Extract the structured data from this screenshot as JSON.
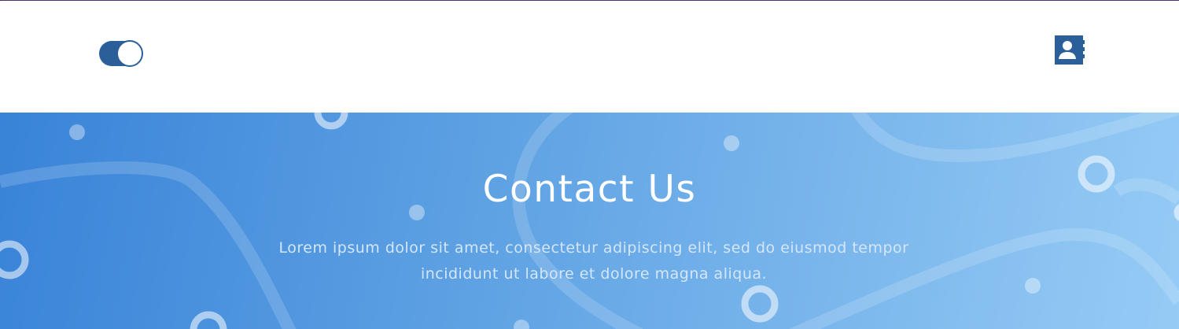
{
  "header": {
    "logo_icon": "toggle-logo-icon",
    "contact_icon": "contact-card-icon",
    "colors": {
      "brand": "#2b5f9a",
      "background": "#ffffff"
    }
  },
  "hero": {
    "title": "Contact Us",
    "description": "Lorem ipsum dolor sit amet, consectetur adipiscing elit, sed do eiusmod tempor incididunt ut labore et dolore magna aliqua.",
    "colors": {
      "gradient_start": "#3983d8",
      "gradient_end": "#95cbf5",
      "title": "#ffffff",
      "text": "#d4e6fb"
    }
  }
}
